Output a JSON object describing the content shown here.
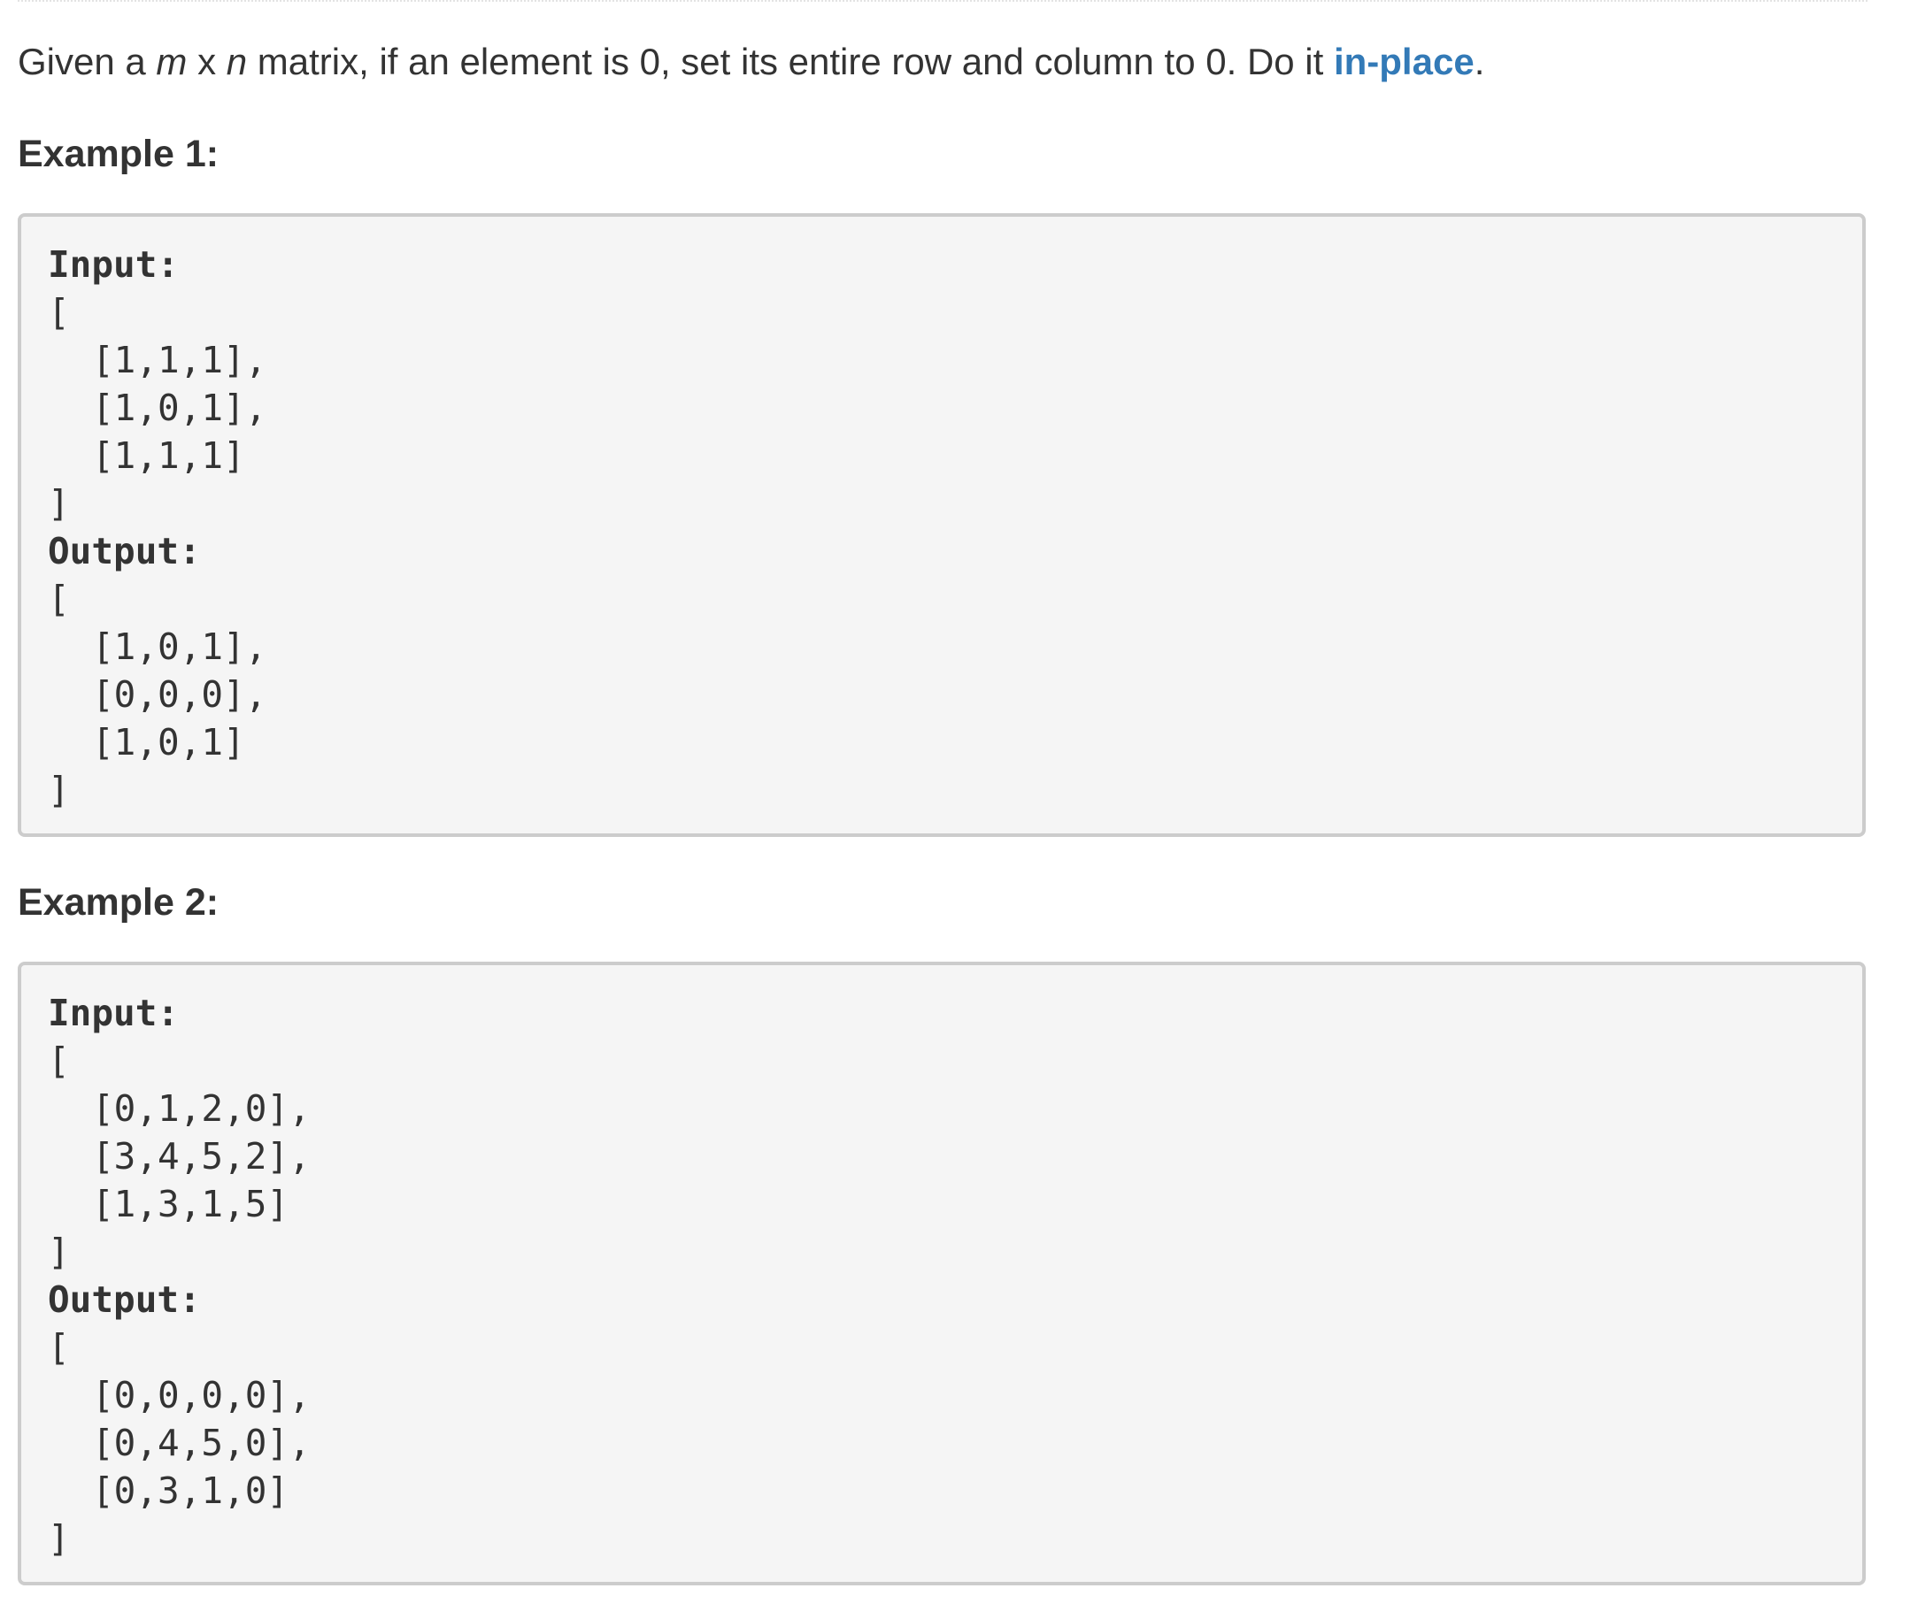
{
  "description": {
    "before": "Given a ",
    "m": "m",
    "x": " x ",
    "n": "n",
    "middle": " matrix, if an element is 0, set its entire row and column to 0. Do it ",
    "link": "in-place",
    "after": "."
  },
  "examples": [
    {
      "title": "Example 1:",
      "input_label": "Input:",
      "open_bracket": "[",
      "input_rows": [
        "[1,1,1],",
        "[1,0,1],",
        "[1,1,1]"
      ],
      "close_bracket": "]",
      "output_label": "Output:",
      "output_rows": [
        "[1,0,1],",
        "[0,0,0],",
        "[1,0,1]"
      ]
    },
    {
      "title": "Example 2:",
      "input_label": "Input:",
      "open_bracket": "[",
      "input_rows": [
        "[0,1,2,0],",
        "[3,4,5,2],",
        "[1,3,1,5]"
      ],
      "close_bracket": "]",
      "output_label": "Output:",
      "output_rows": [
        "[0,0,0,0],",
        "[0,4,5,0],",
        "[0,3,1,0]"
      ]
    }
  ],
  "colors": {
    "link": "#337ab7",
    "text": "#333333",
    "code_background": "#f5f5f5",
    "code_border": "#cccccc"
  }
}
